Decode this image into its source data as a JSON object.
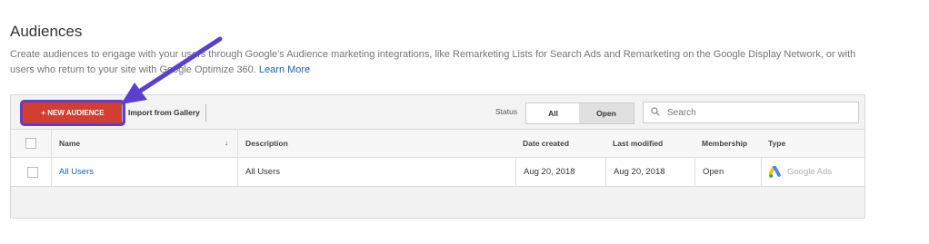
{
  "page": {
    "title": "Audiences",
    "description": "Create audiences to engage with your users through Google's Audience marketing integrations, like Remarketing Lists for Search Ads and Remarketing on the Google Display Network, or with users who return to your site with Google Optimize 360.",
    "learn_more": "Learn More"
  },
  "toolbar": {
    "new_audience": "+ NEW AUDIENCE",
    "import_gallery": "Import from Gallery",
    "status_label": "Status",
    "status_all": "All",
    "status_open": "Open",
    "status_selected": "Open",
    "search_placeholder": "Search"
  },
  "table": {
    "columns": [
      "Name",
      "Description",
      "Date created",
      "Last modified",
      "Membership",
      "Type"
    ],
    "rows": [
      {
        "name": "All Users",
        "description": "All Users",
        "date_created": "Aug 20, 2018",
        "last_modified": "Aug 20, 2018",
        "membership": "Open",
        "type": "Google Ads",
        "type_icon": "google-ads-logo"
      }
    ]
  },
  "colors": {
    "new_audience_bg": "#d23f31",
    "highlight_arrow": "#5c3fcf",
    "link": "#1565c0"
  }
}
